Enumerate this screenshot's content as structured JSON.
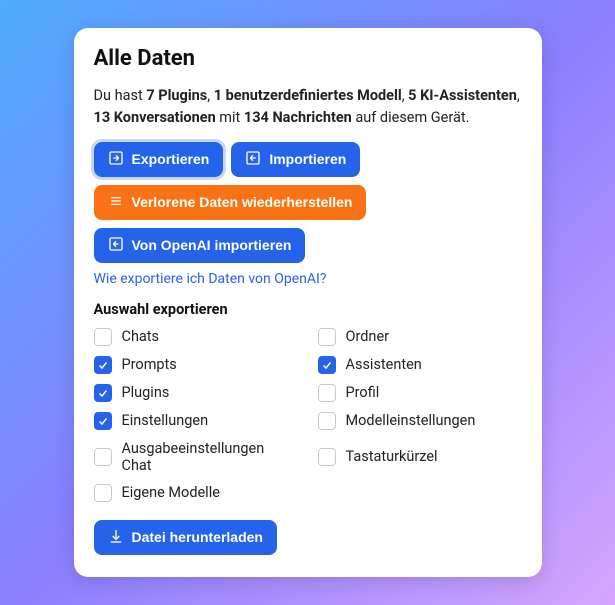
{
  "title": "Alle Daten",
  "summary": {
    "pre": "Du hast ",
    "plugins": "7 Plugins",
    "sep1": ", ",
    "models": "1 benutzerdefiniertes Modell",
    "sep2": ", ",
    "assistants": "5 KI-Assistenten",
    "sep3": ", ",
    "conversations": "13 Konversationen",
    "with": " mit ",
    "messages": "134 Nachrichten",
    "post": " auf diesem Gerät."
  },
  "buttons": {
    "export": "Exportieren",
    "import": "Importieren",
    "restore": "Verlorene Daten wiederherstellen",
    "openai_import": "Von OpenAI importieren",
    "download": "Datei herunterladen"
  },
  "links": {
    "openai_help": "Wie exportiere ich Daten von OpenAI?"
  },
  "selection_label": "Auswahl exportieren",
  "checks": {
    "chats": {
      "label": "Chats",
      "checked": false
    },
    "folders": {
      "label": "Ordner",
      "checked": false
    },
    "prompts": {
      "label": "Prompts",
      "checked": true
    },
    "assist": {
      "label": "Assistenten",
      "checked": true
    },
    "plugins": {
      "label": "Plugins",
      "checked": true
    },
    "profile": {
      "label": "Profil",
      "checked": false
    },
    "settings": {
      "label": "Einstellungen",
      "checked": true
    },
    "modelset": {
      "label": "Modelleinstellungen",
      "checked": false
    },
    "output": {
      "label": "Ausgabeeinstellungen Chat",
      "checked": false
    },
    "shortcut": {
      "label": "Tastaturkürzel",
      "checked": false
    },
    "owncust": {
      "label": "Eigene Modelle",
      "checked": false
    }
  }
}
